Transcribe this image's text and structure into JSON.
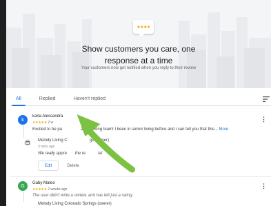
{
  "hero": {
    "title_line1": "Show customers you care, one",
    "title_line2": "response at a time",
    "subtitle": "Your customers now get notified when you reply to their review",
    "bubble_icon": "review-stars-icon"
  },
  "tabs": [
    {
      "label": "All",
      "active": true
    },
    {
      "label": "Replied",
      "active": false
    },
    {
      "label": "Haven't replied",
      "active": false
    }
  ],
  "sort_icon": "sort-icon",
  "reviews": [
    {
      "avatar_letter": "k",
      "avatar_color": "#1a73e8",
      "name": "karla Alessandra",
      "stars": "★★★★★",
      "rating": 5,
      "time": "2 w",
      "text": "Excited to be pa",
      "text_tail": "ard working team! I been in senior living before and i can tell you that this...",
      "more_label": "More",
      "owner_name": "Melody Living C",
      "owner_name_tail": "gs (owner)",
      "owner_time": "3 mins ago",
      "owner_reply": "We really appre",
      "owner_reply_tail": "the re",
      "owner_reply_end": "la!",
      "edit_label": "Edit",
      "delete_label": "Delete"
    },
    {
      "avatar_letter": "G",
      "avatar_color": "#34a853",
      "name": "Gaby Mateo",
      "stars": "★★★★★",
      "rating": 5,
      "time": "2 weeks ago",
      "text": "The user didn't write a review, and has left just a rating.",
      "owner_name": "Melody Living Colorado Springs (owner)"
    }
  ],
  "colors": {
    "accent": "#1a73e8",
    "star": "#f2a600",
    "arrow": "#7cc242"
  }
}
